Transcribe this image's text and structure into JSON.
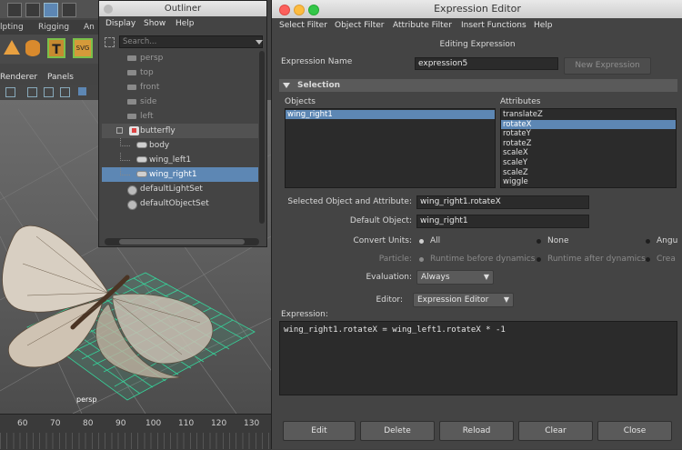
{
  "maya": {
    "shelf_tabs": [
      "lpting",
      "Rigging",
      "An"
    ],
    "panel_menu": [
      "Renderer",
      "Panels"
    ],
    "viewport_label": "persp",
    "timeline_ticks": [
      "60",
      "70",
      "80",
      "90",
      "100",
      "110",
      "120",
      "130"
    ]
  },
  "outliner": {
    "title": "Outliner",
    "menu": [
      "Display",
      "Show",
      "Help"
    ],
    "search_placeholder": "Search...",
    "items": [
      {
        "label": "persp",
        "indent": 1,
        "state": "dim"
      },
      {
        "label": "top",
        "indent": 1,
        "state": "dim"
      },
      {
        "label": "front",
        "indent": 1,
        "state": "dim"
      },
      {
        "label": "side",
        "indent": 1,
        "state": "dim"
      },
      {
        "label": "left",
        "indent": 1,
        "state": "dim"
      },
      {
        "label": "butterfly",
        "indent": 0,
        "state": "group"
      },
      {
        "label": "body",
        "indent": 2,
        "state": "normal"
      },
      {
        "label": "wing_left1",
        "indent": 2,
        "state": "normal"
      },
      {
        "label": "wing_right1",
        "indent": 2,
        "state": "selected"
      },
      {
        "label": "defaultLightSet",
        "indent": 1,
        "state": "normal"
      },
      {
        "label": "defaultObjectSet",
        "indent": 1,
        "state": "normal"
      }
    ]
  },
  "expression_editor": {
    "title": "Expression Editor",
    "menu": [
      "Select Filter",
      "Object Filter",
      "Attribute Filter",
      "Insert Functions",
      "Help"
    ],
    "subtitle": "Editing Expression",
    "expression_name_label": "Expression Name",
    "expression_name_value": "expression5",
    "new_expression_label": "New Expression",
    "selection_header": "Selection",
    "objects_label": "Objects",
    "attributes_label": "Attributes",
    "objects": [
      "wing_right1"
    ],
    "selected_object": "wing_right1",
    "attributes": [
      "translateZ",
      "rotateX",
      "rotateY",
      "rotateZ",
      "scaleX",
      "scaleY",
      "scaleZ",
      "wiggle"
    ],
    "selected_attribute": "rotateX",
    "selected_obj_attr_label": "Selected Object and Attribute:",
    "selected_obj_attr_value": "wing_right1.rotateX",
    "default_object_label": "Default Object:",
    "default_object_value": "wing_right1",
    "convert_units_label": "Convert Units:",
    "convert_units_options": [
      "All",
      "None",
      "Angu"
    ],
    "particle_label": "Particle:",
    "particle_options": [
      "Runtime before dynamics",
      "Runtime after dynamics",
      "Crea"
    ],
    "evaluation_label": "Evaluation:",
    "evaluation_value": "Always",
    "editor_label": "Editor:",
    "editor_value": "Expression Editor",
    "expression_label": "Expression:",
    "expression_text": "wing_right1.rotateX = wing_left1.rotateX * -1",
    "buttons": [
      "Edit",
      "Delete",
      "Reload",
      "Clear",
      "Close"
    ]
  },
  "colors": {
    "selection_blue": "#5d87b4",
    "grid_green": "#36d39a"
  }
}
